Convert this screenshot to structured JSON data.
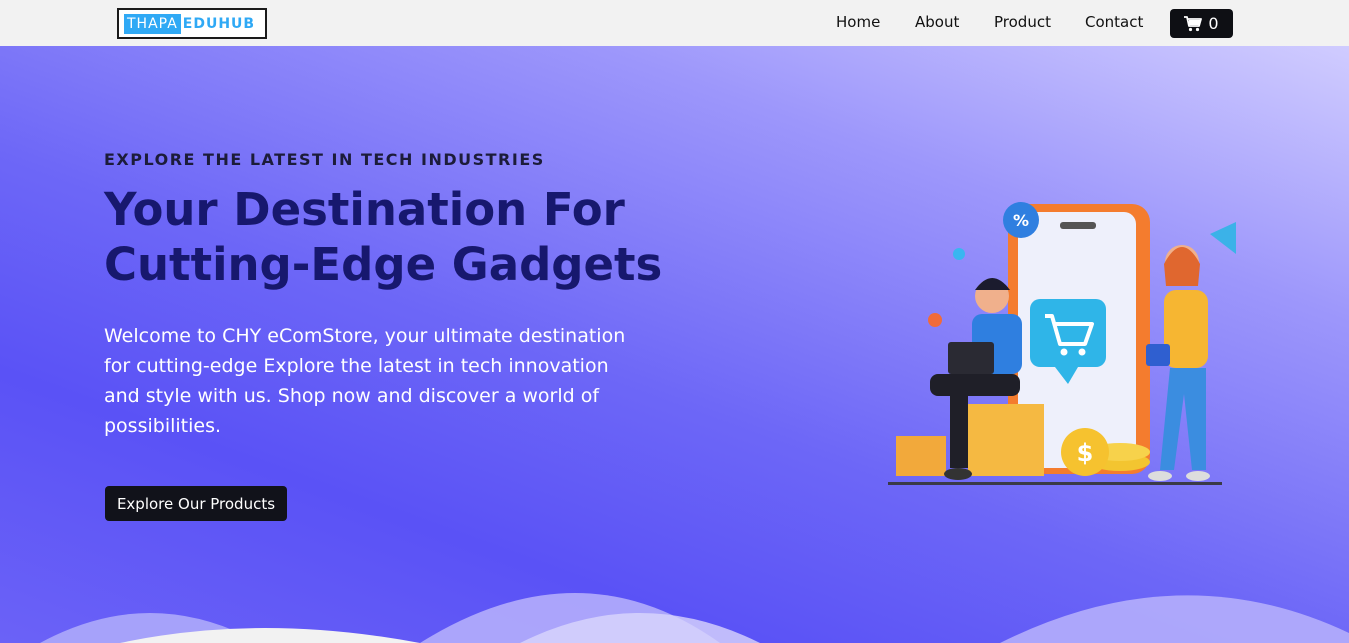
{
  "brand": {
    "logo_part1": "THAPA",
    "logo_part2": "EDUHUB"
  },
  "nav": {
    "items": [
      {
        "label": "Home"
      },
      {
        "label": "About"
      },
      {
        "label": "Product"
      },
      {
        "label": "Contact"
      }
    ],
    "cart_icon": "cart-icon",
    "cart_count": "0"
  },
  "hero": {
    "subtitle": "EXPLORE THE LATEST IN TECH INDUSTRIES",
    "title": "Your Destination For Cutting-Edge Gadgets",
    "description": "Welcome to CHY eComStore, your ultimate destination for cutting-edge Explore the latest in tech innovation and style with us. Shop now and discover a world of possibilities.",
    "cta_label": "Explore Our Products"
  },
  "colors": {
    "accent": "#2fa9f5",
    "hero_title": "#17186e",
    "button_dark": "#0e0f14",
    "hero_gradient_start": "#d0ccff",
    "hero_gradient_end": "#5a52f6"
  }
}
